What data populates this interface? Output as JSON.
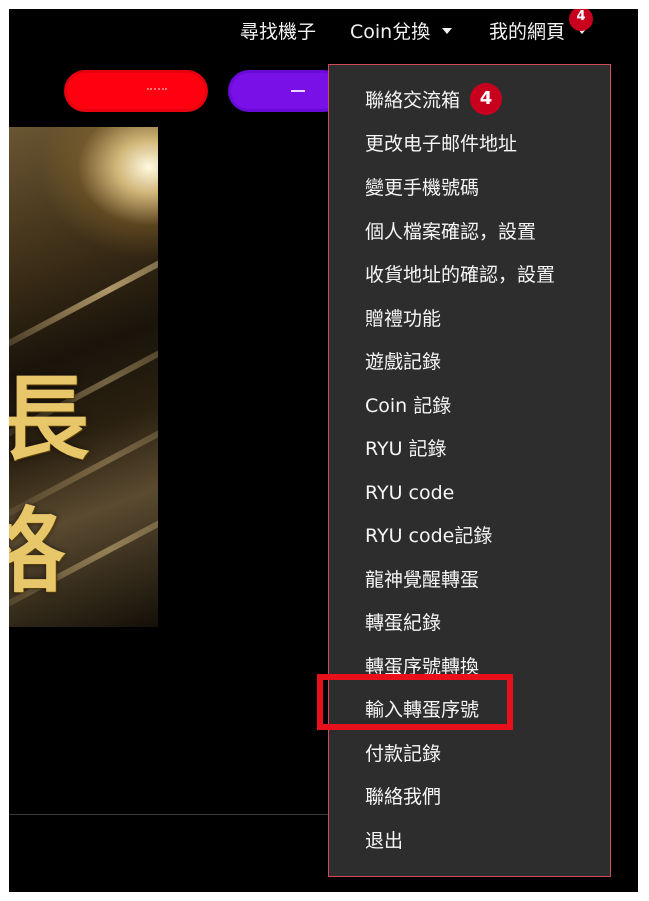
{
  "nav": {
    "find_machine": "尋找機子",
    "coin_exchange": "Coin兌換",
    "my_page": "我的網頁",
    "my_page_badge": "4"
  },
  "banner": {
    "line1": "長",
    "line2": "格"
  },
  "menu": {
    "items": [
      {
        "label": "聯絡交流箱",
        "badge": "4"
      },
      {
        "label": "更改电子邮件地址"
      },
      {
        "label": "變更手機號碼"
      },
      {
        "label": "個人檔案確認，設置"
      },
      {
        "label": "收貨地址的確認，設置"
      },
      {
        "label": "贈禮功能"
      },
      {
        "label": "遊戲記錄"
      },
      {
        "label": "Coin 記錄"
      },
      {
        "label": "RYU 記錄"
      },
      {
        "label": "RYU code"
      },
      {
        "label": "RYU code記錄"
      },
      {
        "label": "龍神覺醒轉蛋"
      },
      {
        "label": "轉蛋紀錄"
      },
      {
        "label": "轉蛋序號轉換"
      },
      {
        "label": "輸入轉蛋序號"
      },
      {
        "label": "付款記錄"
      },
      {
        "label": "聯絡我們"
      },
      {
        "label": "退出"
      }
    ]
  },
  "colors": {
    "background": "#000000",
    "dropdown_bg": "#2d2d2d",
    "badge": "#c8001e",
    "highlight": "#e8101a",
    "red_button": "#ff0010",
    "purple_button": "#7a10e8"
  }
}
